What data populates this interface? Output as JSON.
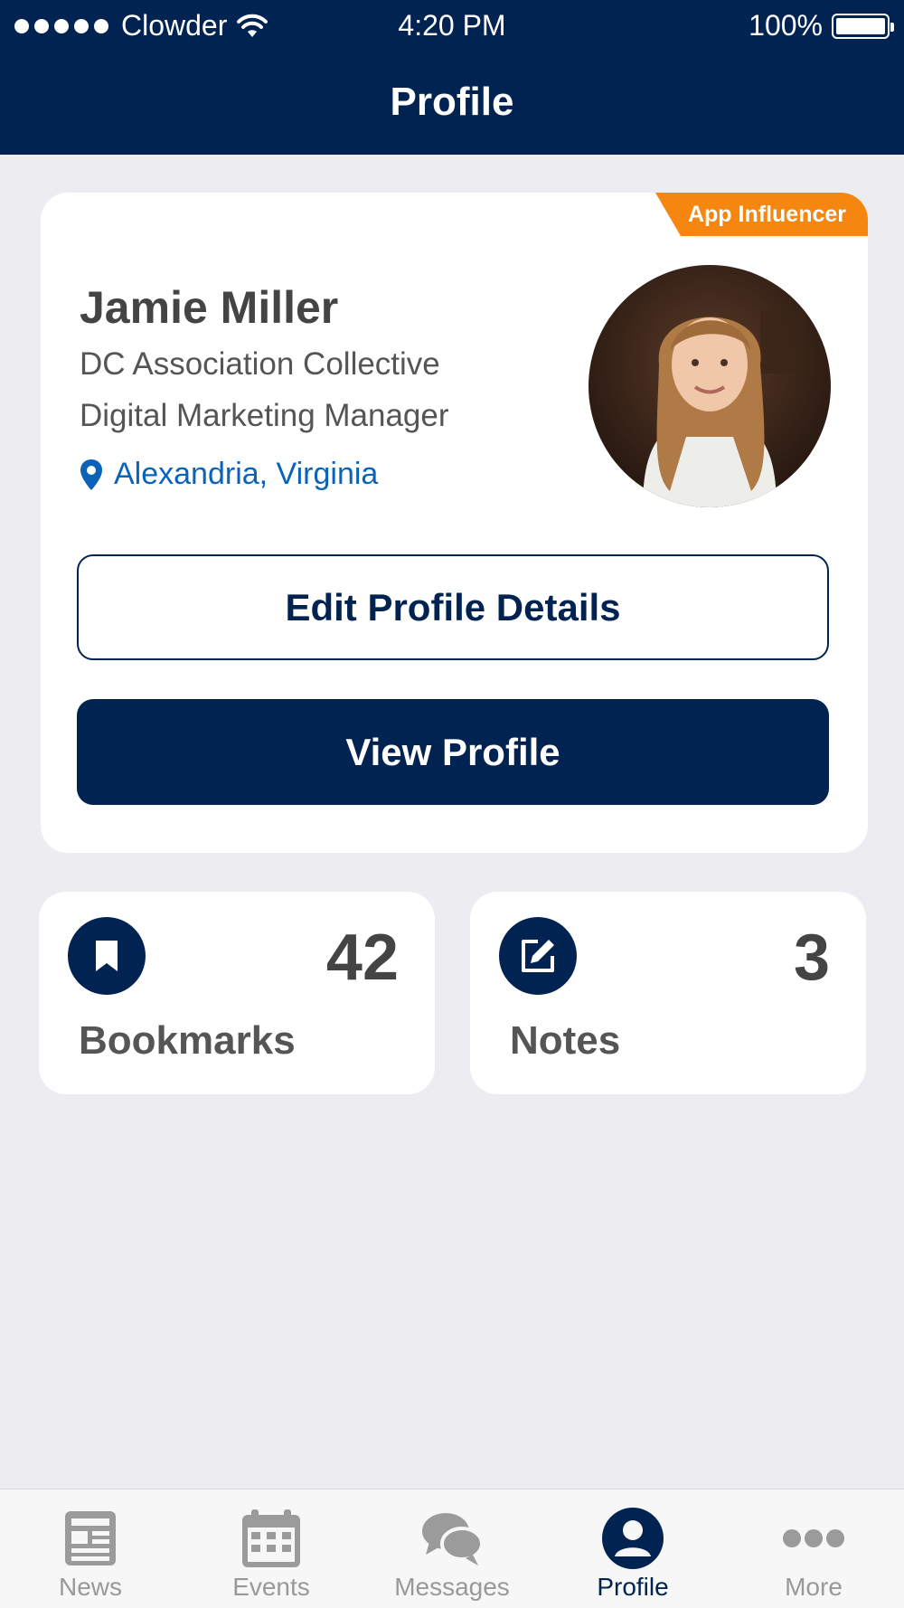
{
  "status_bar": {
    "carrier": "Clowder",
    "time": "4:20 PM",
    "battery": "100%"
  },
  "header": {
    "title": "Profile"
  },
  "profile": {
    "badge": "App Influencer",
    "name": "Jamie Miller",
    "organization": "DC Association Collective",
    "role": "Digital Marketing Manager",
    "location": "Alexandria, Virginia",
    "edit_button": "Edit Profile Details",
    "view_button": "View Profile"
  },
  "stats": {
    "bookmarks": {
      "count": "42",
      "label": "Bookmarks",
      "icon": "bookmark-icon"
    },
    "notes": {
      "count": "3",
      "label": "Notes",
      "icon": "edit-note-icon"
    }
  },
  "tabbar": {
    "items": [
      {
        "label": "News",
        "icon": "news-icon"
      },
      {
        "label": "Events",
        "icon": "calendar-icon"
      },
      {
        "label": "Messages",
        "icon": "chat-bubbles-icon"
      },
      {
        "label": "Profile",
        "icon": "person-icon",
        "active": true
      },
      {
        "label": "More",
        "icon": "more-icon"
      }
    ]
  },
  "colors": {
    "navy": "#012352",
    "accent_orange": "#F5860F",
    "link_blue": "#0A63B8",
    "background": "#ECECF1"
  }
}
